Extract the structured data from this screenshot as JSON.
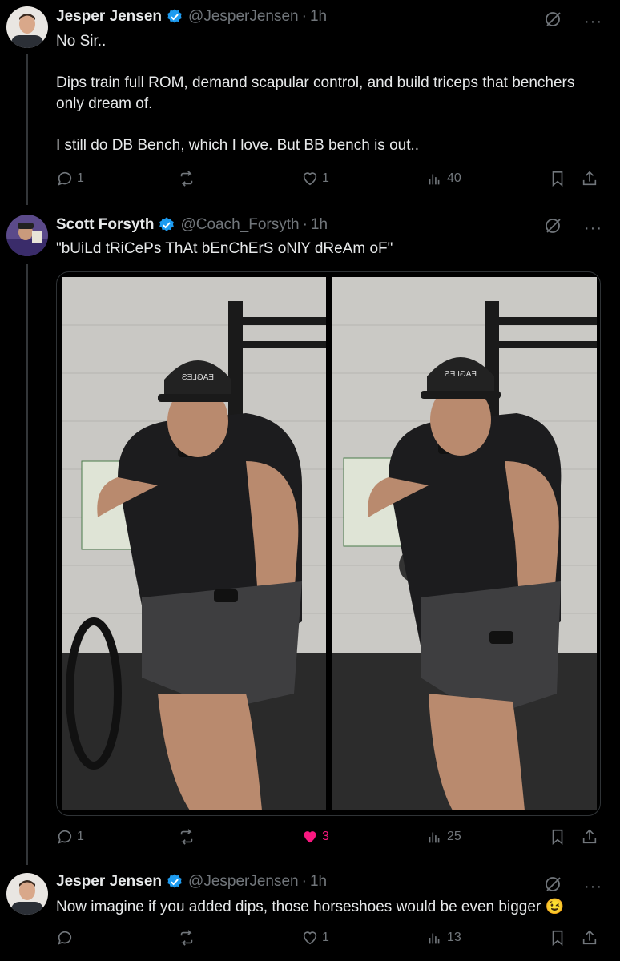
{
  "tweets": [
    {
      "name": "Jesper Jensen",
      "handle": "@JesperJensen",
      "time": "1h",
      "text": "No Sir..\n\nDips train full ROM, demand scapular control, and build triceps that benchers only dream of.\n\nI still do DB Bench, which I love. But BB bench is out..",
      "replies": "1",
      "reposts": "",
      "likes": "1",
      "views": "40"
    },
    {
      "name": "Scott Forsyth",
      "handle": "@Coach_Forsyth",
      "time": "1h",
      "text": "\"bUiLd tRiCePs ThAt bEnChErS oNlY dReAm oF\"",
      "replies": "1",
      "reposts": "",
      "likes": "3",
      "views": "25",
      "media": {
        "left_photo": {
          "cap_text": "EAGLES"
        },
        "right_photo": {
          "cap_text": "EAGLES"
        }
      }
    },
    {
      "name": "Jesper Jensen",
      "handle": "@JesperJensen",
      "time": "1h",
      "text": "Now imagine if you added dips, those horseshoes would be even bigger 😉",
      "replies": "",
      "reposts": "",
      "likes": "1",
      "views": "13"
    }
  ],
  "icons": {
    "reply": "reply-icon",
    "repost": "repost-icon",
    "like": "heart-icon",
    "views": "views-icon",
    "bookmark": "bookmark-icon",
    "share": "share-icon",
    "grok": "grok-icon",
    "more": "more-icon",
    "verified": "verified-badge-icon"
  },
  "colors": {
    "background": "#000000",
    "text": "#e7e9ea",
    "muted": "#71767b",
    "verified": "#1d9bf0",
    "like_active": "#f91880"
  }
}
